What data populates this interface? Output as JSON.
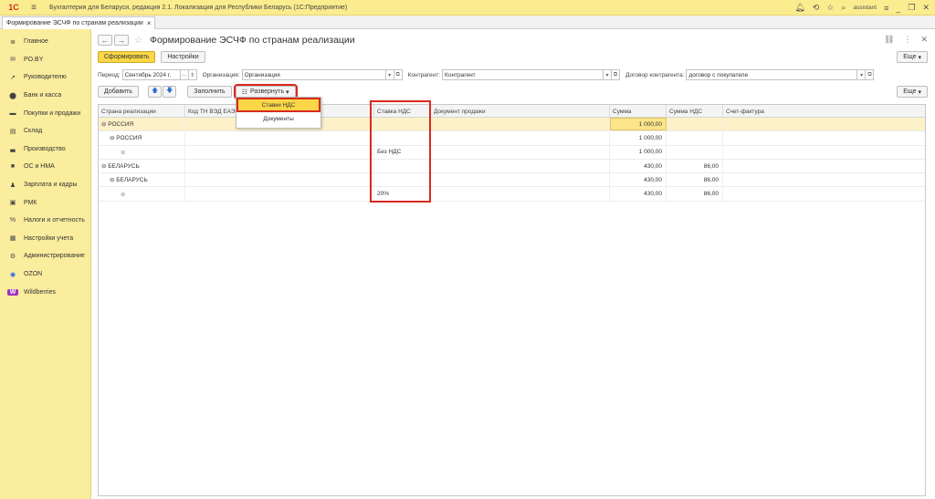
{
  "app": {
    "logo": "1С",
    "title": "Бухгалтерия для Беларуси, редакция 2.1. Локализация для Республики Беларусь   (1С:Предприятие)",
    "user": "assistant"
  },
  "tab": {
    "label": "Формирование ЭСЧФ по странам реализации",
    "close": "×"
  },
  "sidebar": {
    "items": [
      {
        "label": "Главное",
        "icon": "≣"
      },
      {
        "label": "PO.BY",
        "icon": "✉"
      },
      {
        "label": "Руководителю",
        "icon": "↗"
      },
      {
        "label": "Банк и касса",
        "icon": "⬤"
      },
      {
        "label": "Покупки и продажи",
        "icon": "▬"
      },
      {
        "label": "Склад",
        "icon": "▤"
      },
      {
        "label": "Производство",
        "icon": "▃"
      },
      {
        "label": "ОС и НМА",
        "icon": "■"
      },
      {
        "label": "Зарплата и кадры",
        "icon": "♟"
      },
      {
        "label": "РМК",
        "icon": "▣"
      },
      {
        "label": "Налоги и отчетность",
        "icon": "%"
      },
      {
        "label": "Настройки учета",
        "icon": "▦"
      },
      {
        "label": "Администрирование",
        "icon": "⚙"
      },
      {
        "label": "OZON",
        "icon": "◉"
      },
      {
        "label": "Wildberries",
        "icon": "W"
      }
    ]
  },
  "page": {
    "title": "Формирование ЭСЧФ по странам реализации",
    "generate_label": "Сформировать",
    "settings_label": "Настройки",
    "more_label": "Еще"
  },
  "filters": {
    "period_label": "Период:",
    "period_value": "Сентябрь 2024 г.",
    "org_label": "Организация:",
    "org_value": "Организация",
    "counterparty_label": "Контрагент:",
    "counterparty_value": "Контрагент",
    "contract_label": "Договор контрагента:",
    "contract_value": "договор с покупателе"
  },
  "toolbar": {
    "add_label": "Добавить",
    "fill_label": "Заполнить",
    "expand_label": "Развернуть"
  },
  "dropdown": {
    "items": [
      "Ставки НДС",
      "Документы"
    ]
  },
  "table": {
    "columns": [
      "Страна реализации",
      "Код ТН ВЭД ЕАЭС",
      "Ставка НДС",
      "Документ продажи",
      "Сумма",
      "Сумма НДС",
      "Счет-фактура"
    ],
    "rows": [
      {
        "c1": "⊖ РОССИЯ",
        "c3": "",
        "sum": "1 000,00",
        "vat": ""
      },
      {
        "c1": "⊖ РОССИЯ",
        "c3": "",
        "sum": "1 000,00",
        "vat": ""
      },
      {
        "c1": "⊕",
        "c3": "Без НДС",
        "sum": "1 000,00",
        "vat": ""
      },
      {
        "c1": "⊖ БЕЛАРУСЬ",
        "c3": "",
        "sum": "430,00",
        "vat": "86,00"
      },
      {
        "c1": "⊖ БЕЛАРУСЬ",
        "c3": "",
        "sum": "430,00",
        "vat": "86,00"
      },
      {
        "c1": "⊕",
        "c3": "20%",
        "sum": "430,00",
        "vat": "86,00"
      }
    ]
  },
  "colors": {
    "accent": "#fbd747",
    "sidebar": "#fbed9e",
    "highlight": "#d9281f"
  }
}
